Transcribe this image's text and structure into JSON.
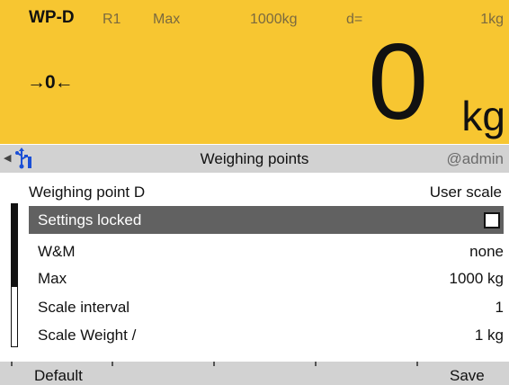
{
  "header": {
    "weighing_point": "WP-D",
    "range": "R1",
    "max_label": "Max",
    "max_value": "1000kg",
    "d_label": "d=",
    "d_value": "1kg"
  },
  "display": {
    "zero_indicator": "→0←",
    "weight": "0",
    "unit": "kg",
    "background_color": "#f7c631"
  },
  "titlebar": {
    "title": "Weighing points",
    "user": "@admin",
    "icons": [
      "left-arrow-icon",
      "usb-icon"
    ]
  },
  "list": {
    "header_left": "Weighing point D",
    "header_right": "User scale",
    "scroll_fraction_visible": 0.58,
    "rows": [
      {
        "label": "Settings locked",
        "value": "",
        "checkbox": true,
        "checked": false,
        "selected": true
      },
      {
        "label": "W&M",
        "value": "none"
      },
      {
        "label": "Max",
        "value": "1000 kg"
      },
      {
        "label": "Scale interval",
        "value": "1"
      },
      {
        "label": "Scale Weight /",
        "value": "1 kg"
      }
    ]
  },
  "softkeys": {
    "left": "Default",
    "right": "Save"
  }
}
